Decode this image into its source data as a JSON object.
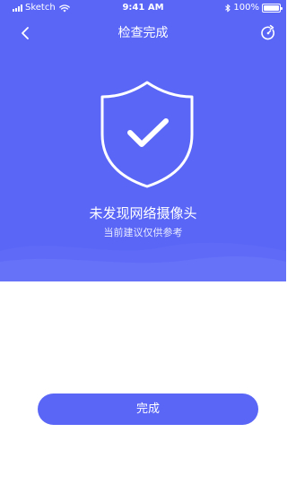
{
  "status_bar": {
    "carrier": "Sketch",
    "time": "9:41 AM",
    "battery": "100%",
    "battery_level": 1.0
  },
  "nav": {
    "title": "检查完成",
    "back_icon": "chevron-left-icon",
    "refresh_icon": "refresh-icon"
  },
  "result": {
    "icon": "shield-check-icon",
    "title": "未发现网络摄像头",
    "subtitle": "当前建议仅供参考"
  },
  "actions": {
    "done_label": "完成"
  },
  "colors": {
    "accent": "#5a66f6",
    "background": "#ffffff",
    "text_on_accent": "#ffffff"
  }
}
